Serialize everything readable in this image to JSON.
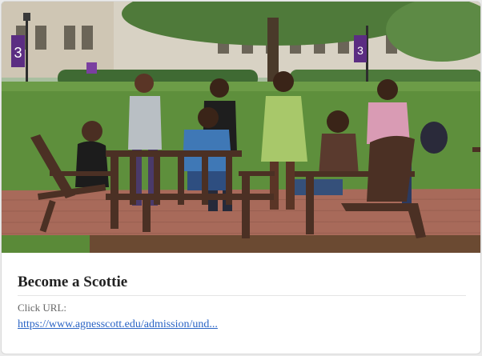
{
  "card": {
    "image_alt": "",
    "title": "Become a Scottie",
    "click_url_label": "Click URL:",
    "click_url": "https://www.agnesscott.edu/admission/und..."
  },
  "banners": [
    "3",
    "",
    "3"
  ],
  "colors": {
    "link": "#2a64c5",
    "title": "#222222",
    "banner_purple": "#5b2d82",
    "grass": "#5e8f3c",
    "brick": "#a86a5a"
  }
}
